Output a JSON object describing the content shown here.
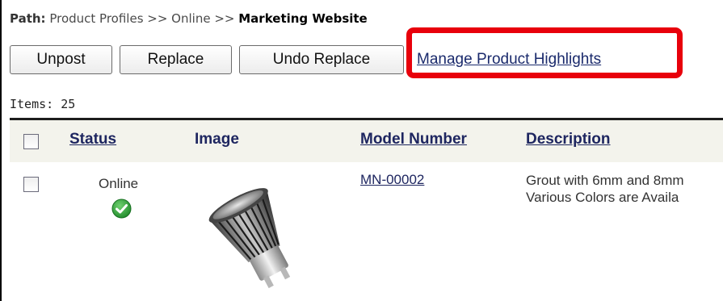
{
  "breadcrumb": {
    "prefix": "Path:",
    "trail": " Product Profiles >> Online >> ",
    "current": "Marketing Website"
  },
  "toolbar": {
    "unpost_label": "Unpost",
    "replace_label": "Replace",
    "undo_replace_label": "Undo Replace",
    "manage_highlights_label": "Manage Product Highlights"
  },
  "highlight_color": "#e8000b",
  "items_count_text": "Items: 25",
  "table": {
    "columns": [
      "Status",
      "Image",
      "Model Number",
      "Description"
    ],
    "rows": [
      {
        "status": "Online",
        "status_icon": "check-circle-icon",
        "image": "led-bulb-image",
        "model_number": "MN-00002",
        "description_line1": "Grout with 6mm and 8mm",
        "description_line2": "Various Colors are Availa"
      }
    ]
  }
}
